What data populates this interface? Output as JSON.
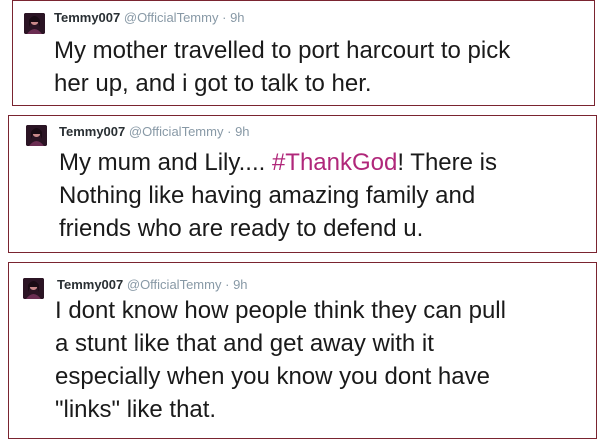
{
  "tweets": [
    {
      "name": "Temmy007",
      "handle": "@OfficialTemmy",
      "separator": "·",
      "time": "9h",
      "lines": [
        "My mother travelled to port harcourt to pick",
        "her up, and i got to talk to her."
      ]
    },
    {
      "name": "Temmy007",
      "handle": "@OfficialTemmy",
      "separator": "·",
      "time": "9h",
      "line1_before": "My mum and Lily.... ",
      "hashtag": "#ThankGod",
      "line1_after": "! There is",
      "lines": [
        "Nothing like having amazing family and",
        "friends who are ready to defend u."
      ]
    },
    {
      "name": "Temmy007",
      "handle": "@OfficialTemmy",
      "separator": "·",
      "time": "9h",
      "lines": [
        "I dont know how people think they can pull",
        "a stunt like that and get away with it",
        "especially when you know you dont have",
        "\"links\" like that."
      ]
    }
  ],
  "colors": {
    "border": "#7a2430",
    "hashtag": "#b0277a",
    "meta": "#8899a6"
  }
}
